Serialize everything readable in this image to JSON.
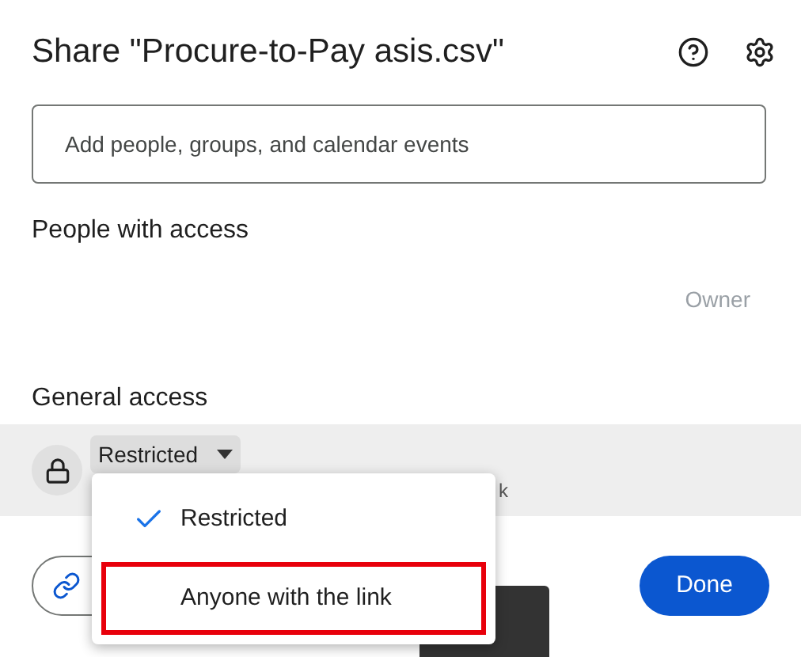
{
  "dialog": {
    "title": "Share \"Procure-to-Pay asis.csv\""
  },
  "add_field": {
    "placeholder": "Add people, groups, and calendar events"
  },
  "people_with_access": {
    "heading": "People with access",
    "role": "Owner"
  },
  "general_access": {
    "heading": "General access",
    "access_button": "Restricted",
    "description": "k"
  },
  "access_menu": [
    {
      "label": "Restricted",
      "selected": true,
      "highlighted": false
    },
    {
      "label": "Anyone with the link",
      "selected": false,
      "highlighted": true
    }
  ],
  "buttons": {
    "done": "Done"
  }
}
